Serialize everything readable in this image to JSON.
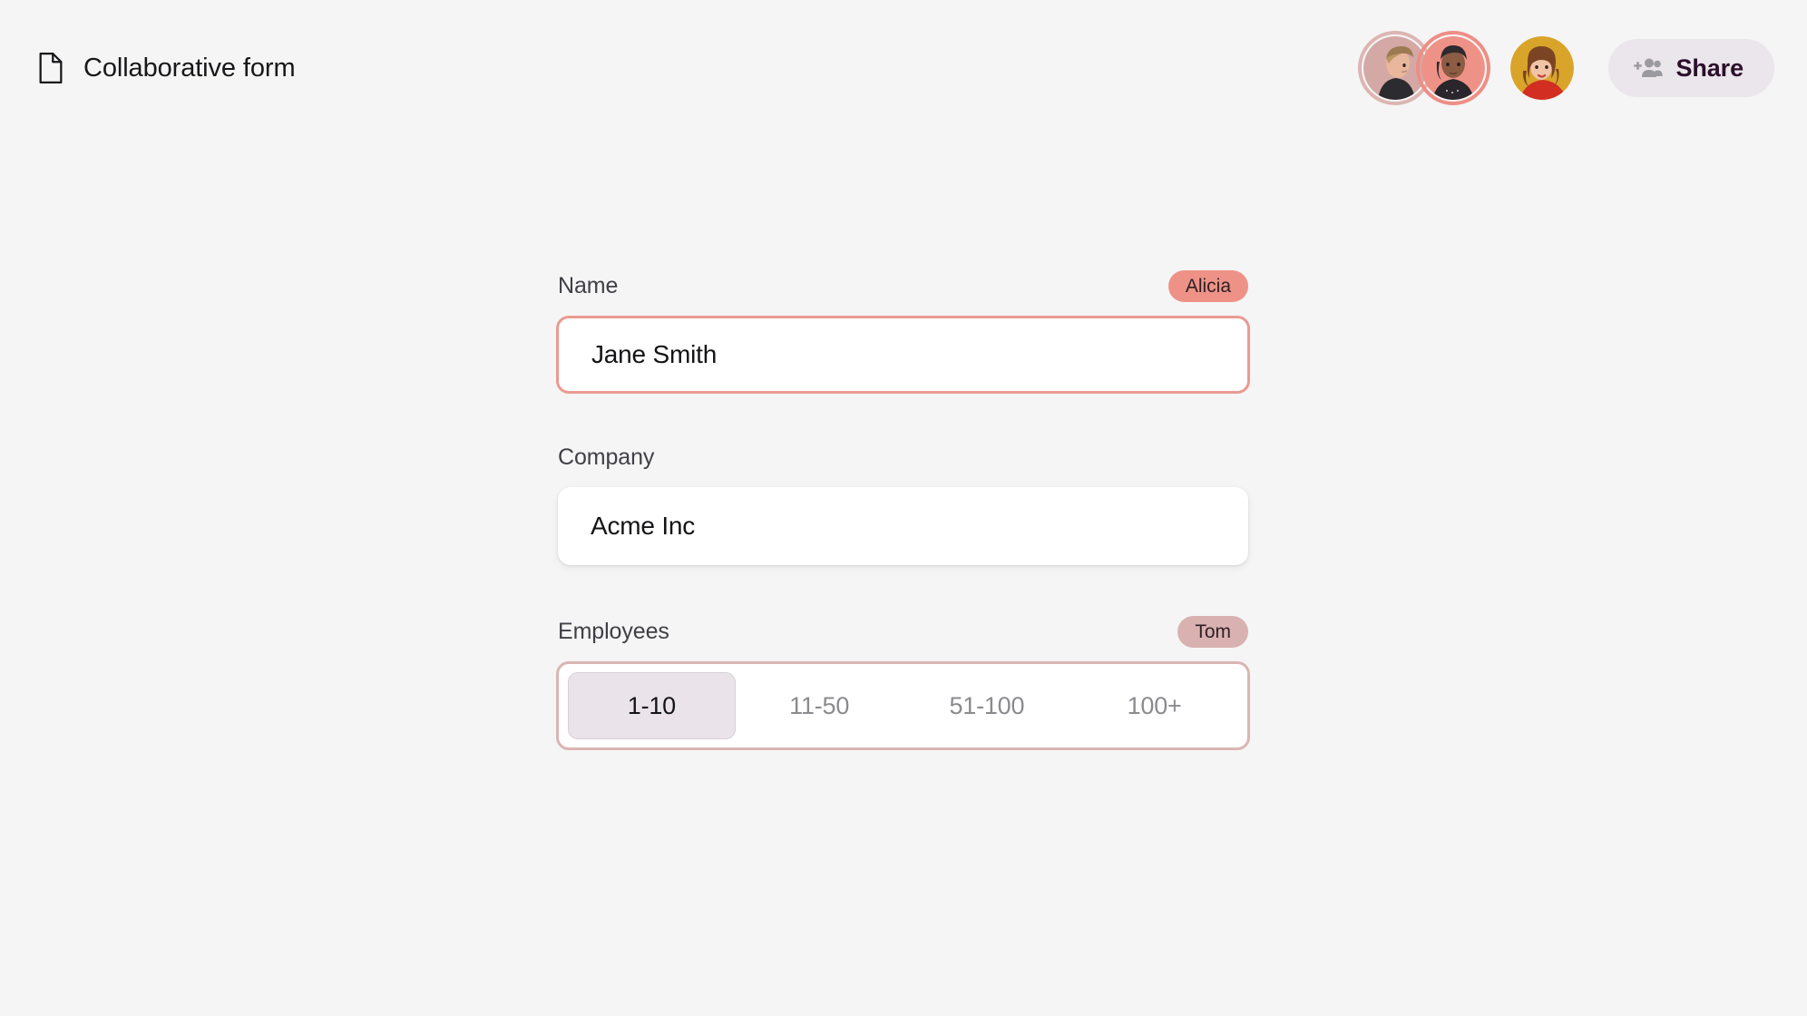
{
  "header": {
    "file_icon": "document-icon",
    "title": "Collaborative form",
    "share": {
      "label": "Share",
      "icon": "add-people-icon",
      "background": "#EAE6EB",
      "text_color": "#2B0F2B"
    },
    "avatars": [
      {
        "name": "avatar-1",
        "ring_color": "#DDB5B2",
        "photo_bg": "#D3A8A5",
        "has_ring": true
      },
      {
        "name": "avatar-2",
        "ring_color": "#EE8E85",
        "photo_bg": "#EE9287",
        "has_ring": true
      },
      {
        "name": "avatar-3",
        "ring_color": "none",
        "photo_bg": "#D9A42A",
        "has_ring": false
      }
    ]
  },
  "form": {
    "fields": [
      {
        "label": "Name",
        "value": "Jane Smith",
        "placeholder": "Name",
        "presence": "Alicia",
        "presence_color": "#EE9287",
        "focused": true
      },
      {
        "label": "Company",
        "value": "Acme Inc",
        "placeholder": "Company",
        "presence": "",
        "presence_color": "",
        "focused": false
      }
    ],
    "employees": {
      "label": "Employees",
      "presence": "Tom",
      "presence_color": "#D9B1B1",
      "border_color": "#D9B6B3",
      "selected": "1-10",
      "options": [
        "1-10",
        "11-50",
        "51-100",
        "100+"
      ]
    }
  },
  "theme": {
    "page_background": "#F5F5F5",
    "focus_border": "#EB9A92",
    "input_background": "#FFFFFF",
    "muted_text": "#8B8B8F"
  }
}
